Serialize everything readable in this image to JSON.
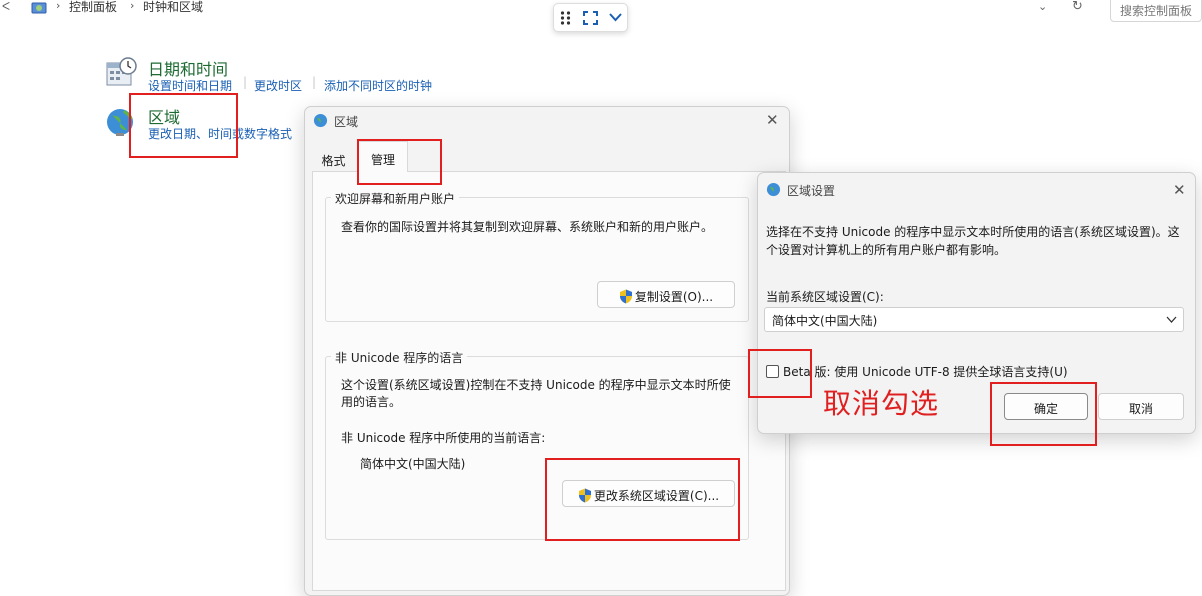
{
  "address_bar": {
    "left_chevron": "ᐸ",
    "crumb1": "控制面板",
    "crumb2": "时钟和区域",
    "search_placeholder": "搜索控制面板"
  },
  "control_panel": {
    "datetime": {
      "title": "日期和时间",
      "links": [
        "设置时间和日期",
        "更改时区",
        "添加不同时区的时钟"
      ]
    },
    "region": {
      "title": "区域",
      "link": "更改日期、时间或数字格式"
    }
  },
  "region_dialog": {
    "title": "区域",
    "tabs": [
      "格式",
      "管理"
    ],
    "welcome_group": {
      "legend": "欢迎屏幕和新用户账户",
      "text": "查看你的国际设置并将其复制到欢迎屏幕、系统账户和新的用户账户。",
      "copy_button": "复制设置(O)..."
    },
    "unicode_group": {
      "legend": "非 Unicode 程序的语言",
      "text_line1": "这个设置(系统区域设置)控制在不支持 Unicode 的程序中显示文本时所使",
      "text_line2": "用的语言。",
      "current_label": "非 Unicode 程序中所使用的当前语言:",
      "current_value": "简体中文(中国大陆)",
      "change_button": "更改系统区域设置(C)..."
    }
  },
  "locale_dialog": {
    "title": "区域设置",
    "desc_line1": "选择在不支持 Unicode 的程序中显示文本时所使用的语言(系统区域设置)。这",
    "desc_line2": "个设置对计算机上的所有用户账户都有影响。",
    "current_label": "当前系统区域设置(C):",
    "current_value": "简体中文(中国大陆)",
    "beta_label": "Beta 版: 使用 Unicode UTF-8 提供全球语言支持(U)",
    "beta_checked": false,
    "ok": "确定",
    "cancel": "取消"
  },
  "annotation": "取消勾选",
  "colors": {
    "annotation_red": "#e21f1f",
    "link_blue": "#1a5fb4",
    "title_green": "#1e6b32"
  }
}
